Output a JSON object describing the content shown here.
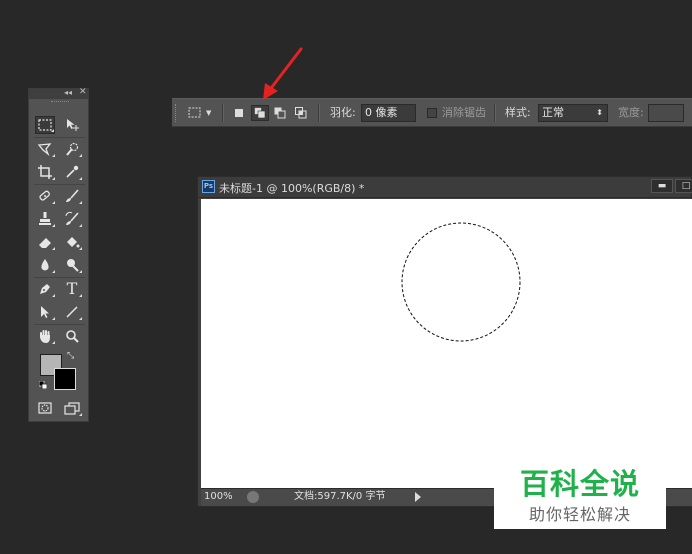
{
  "tools_panel": {
    "collapse_label": "◂◂",
    "close_label": "✕",
    "tools": [
      {
        "name": "rectangular-marquee-tool-icon",
        "active": true
      },
      {
        "name": "move-tool-icon"
      },
      {
        "name": "lasso-tool-icon"
      },
      {
        "name": "quick-selection-tool-icon"
      },
      {
        "name": "crop-tool-icon"
      },
      {
        "name": "eyedropper-tool-icon"
      },
      {
        "name": "healing-brush-tool-icon"
      },
      {
        "name": "brush-tool-icon"
      },
      {
        "name": "clone-stamp-tool-icon"
      },
      {
        "name": "history-brush-tool-icon"
      },
      {
        "name": "eraser-tool-icon"
      },
      {
        "name": "paint-bucket-tool-icon"
      },
      {
        "name": "blur-tool-icon"
      },
      {
        "name": "dodge-tool-icon"
      },
      {
        "name": "pen-tool-icon"
      },
      {
        "name": "type-tool-icon"
      },
      {
        "name": "path-selection-tool-icon"
      },
      {
        "name": "line-tool-icon"
      },
      {
        "name": "hand-tool-icon"
      },
      {
        "name": "zoom-tool-icon"
      },
      {
        "name": "quick-mask-icon"
      },
      {
        "name": "screen-mode-icon"
      }
    ],
    "foreground_color": "#b5b5b5",
    "background_color": "#000000",
    "type_tool_glyph": "T"
  },
  "options_bar": {
    "feather_label": "羽化:",
    "feather_value": "0 像素",
    "antialias_label": "消除锯齿",
    "style_label": "样式:",
    "style_value": "正常",
    "width_label": "宽度:",
    "selection_modes": [
      {
        "name": "new-selection-icon"
      },
      {
        "name": "add-to-selection-icon",
        "active": true
      },
      {
        "name": "subtract-from-selection-icon"
      },
      {
        "name": "intersect-selection-icon"
      }
    ]
  },
  "document": {
    "title": "未标题-1 @ 100%(RGB/8) *",
    "ps_badge": "Ps",
    "zoom": "100%",
    "doc_info": "文档:597.7K/0 字节",
    "minimize_label": "▬",
    "maximize_label": "□"
  },
  "watermark": {
    "title": "百科全说",
    "subtitle": "助你轻松解决"
  },
  "colors": {
    "app_bg": "#282828",
    "panel": "#535353",
    "arrow": "#e52222",
    "watermark_green": "#1fb24a"
  }
}
